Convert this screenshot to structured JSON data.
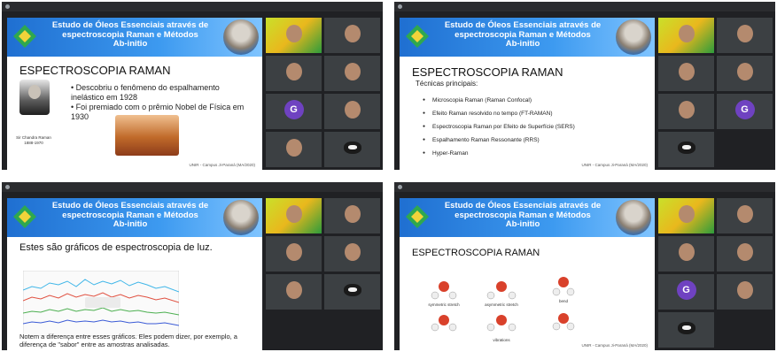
{
  "slide_banner": {
    "line1": "Estudo de Óleos Essenciais através de",
    "line2": "espectroscopia Raman e Métodos",
    "line3": "Ab-initio"
  },
  "footer": "UNIR - Campus Ji-Paraná (MA/2020)",
  "panels": [
    {
      "heading": "ESPECTROSCOPIA RAMAN",
      "bullet1": "• Descobriu o fenômeno do espalhamento inelástico em 1928",
      "bullet2": "• Foi premiado com o prêmio Nobel de Física em 1930",
      "caption": "Sir Chandra Raman 1888-1970",
      "tiles": [
        {
          "name": "",
          "kind": "yellow"
        },
        {
          "name": "",
          "kind": "face"
        },
        {
          "name": "",
          "kind": "face"
        },
        {
          "name": "",
          "kind": "face"
        },
        {
          "name": "",
          "kind": "avatar",
          "letter": "G",
          "color": "#6f42c1"
        },
        {
          "name": "",
          "kind": "face"
        },
        {
          "name": "",
          "kind": "face"
        },
        {
          "name": "",
          "kind": "cat"
        }
      ]
    },
    {
      "heading": "ESPECTROSCOPIA RAMAN",
      "subheading": "Técnicas principais:",
      "bullets": [
        "Microscopia Raman (Raman Confocal)",
        "Efeito Raman resolvido no tempo (FT-RAMAN)",
        "Espectroscopia Raman por Efeito de Superfície (SERS)",
        "Espalhamento Raman Ressonante (RRS)",
        "Hyper-Raman"
      ],
      "tiles": [
        {
          "name": "",
          "kind": "yellow"
        },
        {
          "name": "",
          "kind": "face"
        },
        {
          "name": "",
          "kind": "face"
        },
        {
          "name": "",
          "kind": "face"
        },
        {
          "name": "",
          "kind": "face"
        },
        {
          "name": "",
          "kind": "avatar",
          "letter": "G",
          "color": "#6f42c1"
        },
        {
          "name": "",
          "kind": "cat"
        }
      ]
    },
    {
      "heading": "Estes são gráficos de espectroscopia de luz.",
      "caption": "Notem a diferença entre esses gráficos. Eles podem dizer, por exemplo, a diferença de \"sabor\" entre as amostras analisadas.",
      "tiles": [
        {
          "name": "",
          "kind": "yellow"
        },
        {
          "name": "",
          "kind": "face"
        },
        {
          "name": "",
          "kind": "face"
        },
        {
          "name": "",
          "kind": "face"
        },
        {
          "name": "",
          "kind": "face"
        },
        {
          "name": "",
          "kind": "cat"
        }
      ]
    },
    {
      "heading": "ESPECTROSCOPIA RAMAN",
      "mode_labels": [
        "symmetric stretch",
        "asymmetric stretch",
        "bend",
        "vibrations"
      ],
      "tiles": [
        {
          "name": "",
          "kind": "yellow"
        },
        {
          "name": "",
          "kind": "face"
        },
        {
          "name": "",
          "kind": "face"
        },
        {
          "name": "",
          "kind": "face"
        },
        {
          "name": "",
          "kind": "avatar",
          "letter": "G",
          "color": "#6f42c1"
        },
        {
          "name": "",
          "kind": "face"
        },
        {
          "name": "",
          "kind": "cat"
        }
      ]
    }
  ]
}
